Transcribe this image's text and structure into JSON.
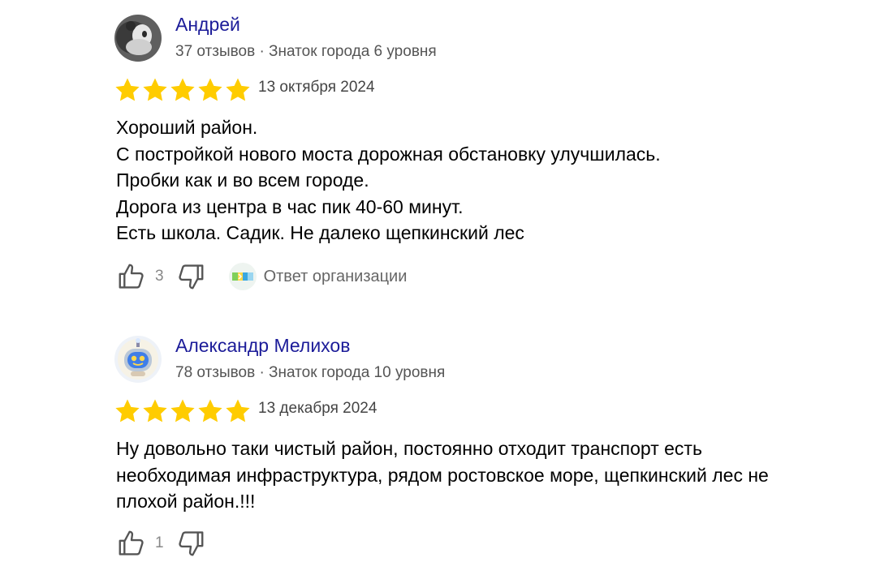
{
  "colors": {
    "author_link": "#1c1c99",
    "star": "#ffcc00",
    "meta_text": "#555555",
    "count_text": "#888888"
  },
  "reviews": [
    {
      "author": "Андрей",
      "meta": "37 отзывов · Знаток города 6 уровня",
      "rating": 5,
      "date": "13 октября 2024",
      "text_lines": [
        "Хороший район.",
        "С постройкой нового моста дорожная обстановку улучшилась.",
        "Пробки как и во всем городе.",
        "Дорога из центра в час пик 40-60 минут.",
        "Есть школа. Садик. Не далеко щепкинский лес"
      ],
      "likes": "3",
      "org_reply_label": "Ответ организации",
      "avatar_icon": "photo-avatar"
    },
    {
      "author": "Александр Мелихов",
      "meta": "78 отзывов · Знаток города 10 уровня",
      "rating": 5,
      "date": "13 декабря 2024",
      "text_lines": [
        "Ну довольно таки чистый район, постоянно отходит транспорт есть",
        "необходимая инфраструктура, рядом ростовское море, щепкинский лес не",
        "плохой район.!!!"
      ],
      "likes": "1",
      "avatar_icon": "robot-avatar"
    }
  ],
  "icons": {
    "like": "thumbs-up-icon",
    "dislike": "thumbs-down-icon",
    "star": "star-icon"
  }
}
